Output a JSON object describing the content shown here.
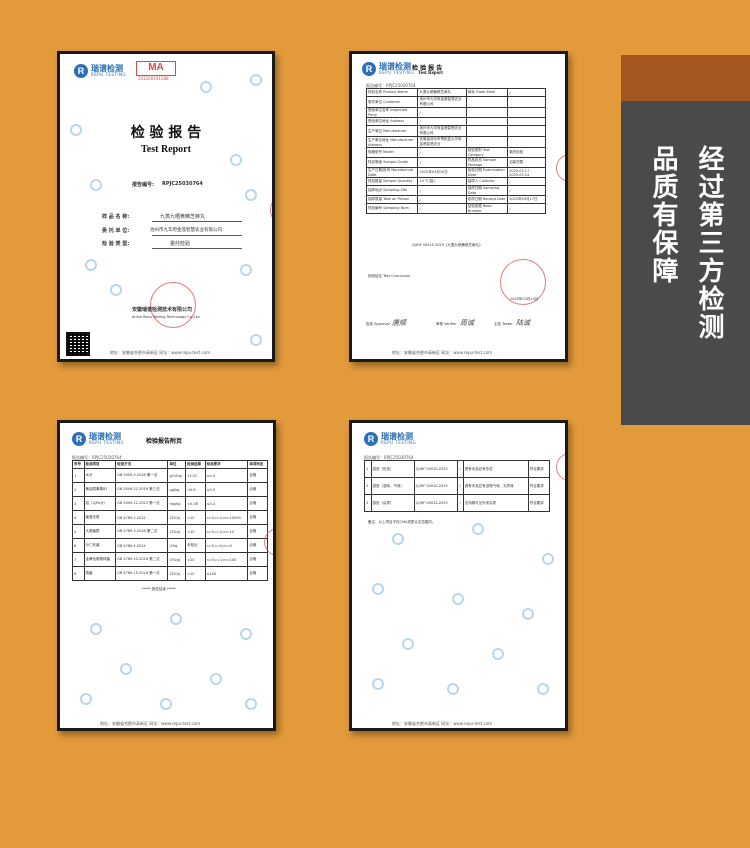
{
  "side_banner": {
    "line1": "经过第三方检测",
    "line2": "品质有保障"
  },
  "doc1": {
    "logo_cn": "瑞谱检测",
    "logo_en": "REPU TESTING",
    "ma_mark": "MA",
    "ma_number": "201200191588",
    "title_cn": "检 验 报 告",
    "title_en": "Test Report",
    "report_no_label": "报告编号:",
    "report_no": "RPJC25030764",
    "fields": [
      {
        "label": "样 品 名 称:",
        "value": "九蒸九晒黄精芝麻丸"
      },
      {
        "label": "委 托 单 位:",
        "value": "池州市九华府金莲智慧农业有限公司"
      },
      {
        "label": "检 验 类 型:",
        "value": "委托检验"
      }
    ],
    "company_cn": "安徽瑞谱检测技术有限公司",
    "company_en": "Anhui Repu Testing Technology Co.,Ltd"
  },
  "doc2": {
    "logo_cn": "瑞谱检测",
    "logo_en": "REPU TESTING",
    "title_cn": "检 验 报 告",
    "title_en": "Test  Report",
    "report_no": "报告编号：RPJC25030764",
    "rows": [
      [
        "样品名称 Product Name",
        "九蒸九晒黄精芝麻丸",
        "商标 Trade Mark",
        "/"
      ],
      [
        "委托单位 Customer",
        "池州市九华府金莲智慧农业有限公司",
        "",
        ""
      ],
      [
        "受检单位名称 Inspected Party",
        "/",
        "",
        ""
      ],
      [
        "受检单位地址 Address",
        "/",
        "",
        ""
      ],
      [
        "生产单位 Manufacturer",
        "池州市九华府金莲智慧农业有限公司",
        "",
        ""
      ],
      [
        "生产单位地址 Manufacturer Address",
        "安徽省池州市青阳县九华府金莲智慧农业",
        "",
        ""
      ],
      [
        "规格型号 Model",
        "/",
        "检验类别 Test Category",
        "委托检验"
      ],
      [
        "样品等级 Sample Grade",
        "/",
        "样品状态 Sample Package",
        "包装完整"
      ],
      [
        "生产日期/批号 Manufacture Date",
        "2025年03月10日",
        "检验日期 Examination Date",
        "2025.03.17-2025.03.24"
      ],
      [
        "样品数量 Sample Quantity",
        "14 个(袋)",
        "抽样人 Collector",
        "/"
      ],
      [
        "抽样地点 Sampling Site",
        "/",
        "抽样日期 Sampling Date",
        "/"
      ],
      [
        "抽样数量 Take on Person",
        "/",
        "收样日期 Receipt Date",
        "2025年03月17日"
      ],
      [
        "样品编号 Sampling Num",
        "/",
        "检验依据 Basic Number",
        "/"
      ]
    ],
    "standard": "Q/JHF 0001S-2025《九蒸九晒黄精芝麻丸》",
    "conclusion_label": "检验结论 Test Conclusion",
    "conclusion_date": "2025年03月24日",
    "sign_labels": [
      "批准 Approval",
      "审核 Verifier",
      "主检 Tester"
    ],
    "signatures": [
      "唐顺",
      "周诚",
      "陆诚"
    ]
  },
  "doc3": {
    "logo_cn": "瑞谱检测",
    "logo_en": "REPU TESTING",
    "title": "检验报告附页",
    "report_no": "报告编号：RPJC25030764",
    "header": [
      "序号",
      "检测项目",
      "检测方法",
      "单位",
      "检测结果",
      "标准要求",
      "单项判定"
    ],
    "rows": [
      [
        "1",
        "水分",
        "GB 5009.3-2016 第一法",
        "g/100g",
        "13.01",
        "≤4.0",
        "合格"
      ],
      [
        "2",
        "黄曲霉毒素B1",
        "GB 5009.22-2016 第三法",
        "μg/kg",
        "<0.6",
        "≤5.0",
        "合格"
      ],
      [
        "3",
        "铅（以Pb计）",
        "GB 5009.12-2023 第一法",
        "mg/kg",
        "<0.08",
        "≤0.4",
        "合格"
      ],
      [
        "4",
        "菌落总数",
        "GB 4789.2-2022",
        "CFU/g",
        "<10",
        "n=5,c=2,m=10000",
        "合格"
      ],
      [
        "5",
        "大肠菌群",
        "GB 4789.3-2016 第二法",
        "CFU/g",
        "<10",
        "n=5,c=2,m=10",
        "合格"
      ],
      [
        "6",
        "沙门氏菌",
        "GB 4789.4-2024",
        "/25g",
        "未检出",
        "n=5,c=0,m=0",
        "合格"
      ],
      [
        "7",
        "金黄色葡萄球菌",
        "GB 4789.10-2016 第二法",
        "CFU/g",
        "<10",
        "n=5,c=1,m=100",
        "合格"
      ],
      [
        "8",
        "霉菌",
        "GB 4789.15-2016 第一法",
        "CFU/g",
        "<10",
        "≤150",
        "合格"
      ]
    ],
    "footer_note": "***** 报告结束 *****"
  },
  "doc4": {
    "logo_cn": "瑞谱检测",
    "logo_en": "REPU TESTING",
    "report_no": "报告编号：RPJC25030764",
    "rows": [
      [
        "1",
        "感官（形态）",
        "Q/JHF 0001S-2025",
        "/",
        "具有本品应有形态",
        "符合要求"
      ],
      [
        "2",
        "感官（滋味、气味）",
        "Q/JHF 0001S-2025",
        "/",
        "具有本品应有滋味气味，无异味",
        "符合要求"
      ],
      [
        "3",
        "感官（杂质）",
        "Q/JHF 0001S-2025",
        "/",
        "无肉眼可见外来杂质",
        "符合要求"
      ]
    ],
    "remark": "备注：以上项目不在CMA资质认定范围内。"
  },
  "footer_small": "地址：安徽省合肥市高新区 网址：www.repu-test.com"
}
